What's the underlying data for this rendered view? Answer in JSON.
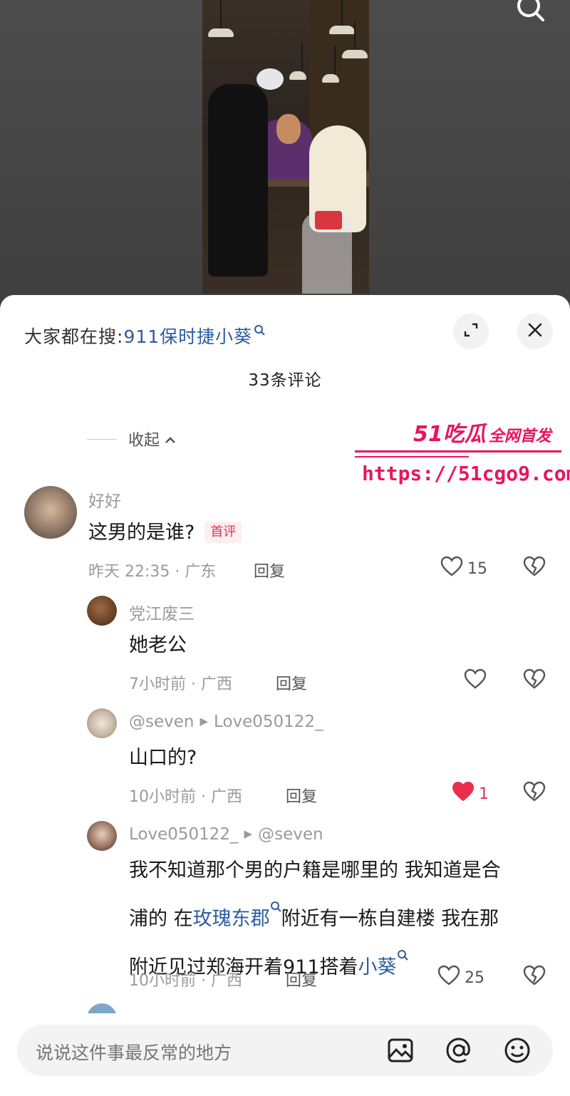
{
  "trending": {
    "prefix": "大家都在搜:",
    "term": "911保时捷小葵"
  },
  "comments_count": "33条评论",
  "collapse_label": "收起",
  "watermark": {
    "line1": "51吃瓜",
    "line1b": "全网首发",
    "url": "https://51cgo9.com"
  },
  "comments": [
    {
      "username": "好好",
      "text": "这男的是谁?",
      "badge": "首评",
      "meta": "昨天 22:35 · 广东",
      "reply": "回复",
      "likes": "15"
    },
    {
      "username": "党江废三",
      "text": "她老公",
      "meta": "7小时前 · 广西",
      "reply": "回复",
      "likes": ""
    },
    {
      "username": "@seven",
      "reply_to": "Love050122_",
      "text": "山口的?",
      "meta": "10小时前 · 广西",
      "reply": "回复",
      "likes": "1",
      "liked": true
    },
    {
      "username": "Love050122_",
      "reply_to": "@seven",
      "text_parts": {
        "a": "我不知道那个男的户籍是哪里的 我知道是合",
        "b": "浦的 在",
        "link1": "玫瑰东郡",
        "c": "附近有一栋自建楼 我在那",
        "d": "附近见过郑海开着911搭着",
        "link2": "小葵"
      },
      "meta": "10小时前 · 广西",
      "reply": "回复",
      "likes": "25"
    }
  ],
  "input": {
    "placeholder": "说说这件事最反常的地方"
  },
  "colors": {
    "link": "#2e5ca0",
    "badge": "#e0324f",
    "liked": "#e8304a",
    "watermark": "#e8145f"
  },
  "icons": [
    "search-icon",
    "expand-icon",
    "close-icon",
    "chevron-up-icon",
    "heart-icon",
    "broken-heart-icon",
    "image-icon",
    "at-icon",
    "emoji-icon"
  ]
}
